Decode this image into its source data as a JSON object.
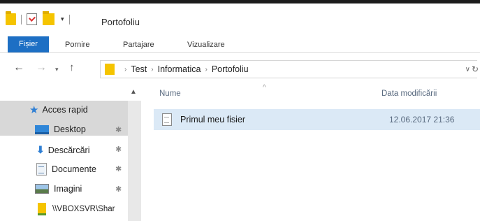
{
  "window": {
    "title": "Portofoliu",
    "quick_access_arrow": "▾"
  },
  "ribbon": {
    "tabs": [
      {
        "label": "Fișier"
      },
      {
        "label": "Pornire"
      },
      {
        "label": "Partajare"
      },
      {
        "label": "Vizualizare"
      }
    ]
  },
  "address": {
    "back": "←",
    "forward": "→",
    "recent": "▾",
    "up": "↑",
    "sep": "›",
    "crumbs": [
      "Test",
      "Informatica",
      "Portofoliu"
    ],
    "dropdown": "∨",
    "refresh": "↻"
  },
  "nav_pane": {
    "scroll_up": "▲",
    "quick_access": "Acces rapid",
    "pin": "✱",
    "items": [
      {
        "label": "Desktop",
        "icon": "desktop-icon"
      },
      {
        "label": "Descărcări",
        "icon": "download-icon"
      },
      {
        "label": "Documente",
        "icon": "documents-icon"
      },
      {
        "label": "Imagini",
        "icon": "pictures-icon"
      },
      {
        "label": "\\\\VBOXSVR\\Shar",
        "icon": "network-share-icon"
      }
    ]
  },
  "content": {
    "columns": {
      "name": "Nume",
      "date": "Data modificării",
      "sort_caret": "^"
    },
    "files": [
      {
        "name": "Primul meu fisier",
        "date": "12.06.2017 21:36"
      }
    ]
  },
  "colors": {
    "accent": "#1d6fc4",
    "folder": "#f5c400",
    "selection": "#dbe9f6"
  }
}
